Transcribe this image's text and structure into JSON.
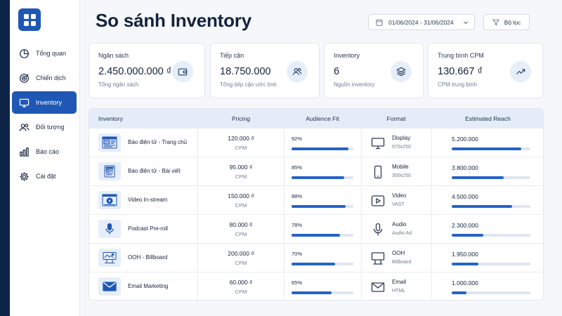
{
  "sidebar": {
    "logo_icon": "grid-icon",
    "items": [
      {
        "label": "Tổng quan",
        "icon": "pie-chart-icon",
        "active": false
      },
      {
        "label": "Chiến dịch",
        "icon": "target-icon",
        "active": false
      },
      {
        "label": "Inventory",
        "icon": "monitor-icon",
        "active": true
      },
      {
        "label": "Đối tượng",
        "icon": "users-icon",
        "active": false
      },
      {
        "label": "Báo cáo",
        "icon": "bar-chart-icon",
        "active": false
      },
      {
        "label": "Cài đặt",
        "icon": "gear-icon",
        "active": false
      }
    ]
  },
  "header": {
    "title": "So sánh Inventory",
    "date_range": "01/06/2024 - 31/06/2024",
    "filter_label": "Bộ lọc"
  },
  "kpis": [
    {
      "label": "Ngân sách",
      "value": "2.450.000.000 ₫",
      "sub": "Tổng ngân sách",
      "icon": "wallet-icon"
    },
    {
      "label": "Tiếp cận",
      "value": "18.750.000",
      "sub": "Tổng tiếp cận ước tính",
      "icon": "users-icon"
    },
    {
      "label": "Inventory",
      "value": "6",
      "sub": "Nguồn inventory",
      "icon": "layers-icon"
    },
    {
      "label": "Trung bình CPM",
      "value": "130.667 ₫",
      "sub": "CPM trung bình",
      "icon": "trend-up-icon"
    }
  ],
  "table": {
    "columns": [
      "Inventory",
      "Pricing",
      "Audience Fit",
      "Format",
      "Estimated Reach"
    ],
    "rows": [
      {
        "inventory": "Báo điện tử - Trang chủ",
        "inv_icon": "webpage-home-icon",
        "price": "120.000 ₫",
        "price_unit": "CPM",
        "fit": "92%",
        "fit_value": 0.92,
        "format": "Display",
        "format_sub": "970x250",
        "format_icon": "desktop-icon",
        "reach": "5.200.000",
        "reach_value": 0.88
      },
      {
        "inventory": "Báo điện tử - Bài viết",
        "inv_icon": "article-icon",
        "price": "95.000 ₫",
        "price_unit": "CPM",
        "fit": "85%",
        "fit_value": 0.85,
        "format": "Mobile",
        "format_sub": "300x250",
        "format_icon": "mobile-icon",
        "reach": "3.800.000",
        "reach_value": 0.66
      },
      {
        "inventory": "Video In-stream",
        "inv_icon": "video-player-icon",
        "price": "150.000 ₫",
        "price_unit": "CPM",
        "fit": "88%",
        "fit_value": 0.88,
        "format": "Video",
        "format_sub": "VAST",
        "format_icon": "play-icon",
        "reach": "4.500.000",
        "reach_value": 0.77
      },
      {
        "inventory": "Podcast Pre-roll",
        "inv_icon": "microphone-icon",
        "price": "80.000 ₫",
        "price_unit": "CPM",
        "fit": "78%",
        "fit_value": 0.78,
        "format": "Audio",
        "format_sub": "Audio Ad",
        "format_icon": "microphone-icon",
        "reach": "2.300.000",
        "reach_value": 0.4
      },
      {
        "inventory": "OOH - Billboard",
        "inv_icon": "billboard-icon",
        "price": "200.000 ₫",
        "price_unit": "CPM",
        "fit": "70%",
        "fit_value": 0.7,
        "format": "OOH",
        "format_sub": "Billboard",
        "format_icon": "billboard-icon",
        "reach": "1.950.000",
        "reach_value": 0.34
      },
      {
        "inventory": "Email Marketing",
        "inv_icon": "envelope-icon",
        "price": "60.000 ₫",
        "price_unit": "CPM",
        "fit": "65%",
        "fit_value": 0.65,
        "format": "Email",
        "format_sub": "HTML",
        "format_icon": "envelope-icon",
        "reach": "1.000.000",
        "reach_value": 0.19
      }
    ]
  },
  "colors": {
    "primary": "#1f57b5",
    "bar": "#2563c7",
    "frame": "#0f2b52",
    "header_row": "#e4ecf8",
    "icon_bg": "#e6eef9"
  }
}
